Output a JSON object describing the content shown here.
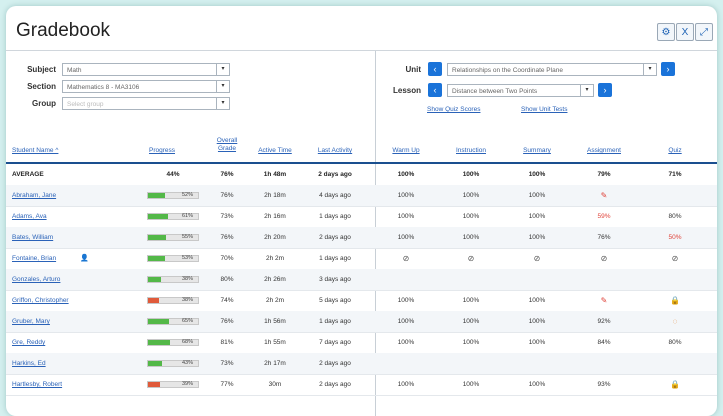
{
  "title": "Gradebook",
  "toolbar": {
    "settings_icon": "gear-icon",
    "export_icon": "excel-icon",
    "expand_icon": "expand-icon"
  },
  "filters": {
    "subject_label": "Subject",
    "subject_value": "Math",
    "section_label": "Section",
    "section_value": "Mathematics 8 - MA3106",
    "group_label": "Group",
    "group_placeholder": "Select group",
    "unit_label": "Unit",
    "unit_value": "Relationships on the Coordinate Plane",
    "lesson_label": "Lesson",
    "lesson_value": "Distance between Two Points",
    "show_quiz_scores": "Show Quiz Scores",
    "show_unit_tests": "Show Unit Tests"
  },
  "columns": {
    "student_name": "Student Name ^",
    "progress": "Progress",
    "overall_grade": "Overall Grade",
    "active_time": "Active Time",
    "last_activity": "Last Activity",
    "warm_up": "Warm Up",
    "instruction": "Instruction",
    "summary": "Summary",
    "assignment": "Assignment",
    "quiz": "Quiz"
  },
  "rows": [
    {
      "name": "AVERAGE",
      "progress": 0.44,
      "progress_text": "44%",
      "grade": "76%",
      "time": "1h 48m",
      "last": "2 days ago",
      "warm": "100%",
      "instr": "100%",
      "summ": "100%",
      "assign": "79%",
      "quiz": "71%",
      "average": true
    },
    {
      "name": "Abraham, Jane",
      "progress": 0.52,
      "progress_text": "52%",
      "grade": "76%",
      "time": "2h 18m",
      "last": "4 days ago",
      "warm": "100%",
      "instr": "100%",
      "summ": "100%",
      "assign_icon": "pencil-icon",
      "assign_glyph": "✎",
      "quiz": ""
    },
    {
      "name": "Adams, Ava",
      "progress": 0.61,
      "progress_text": "61%",
      "grade": "73%",
      "time": "2h 16m",
      "last": "1 days ago",
      "warm": "100%",
      "instr": "100%",
      "summ": "100%",
      "assign": "59%",
      "assign_red": true,
      "quiz": "80%"
    },
    {
      "name": "Bates, William",
      "progress": 0.55,
      "progress_text": "55%",
      "grade": "76%",
      "time": "2h 20m",
      "last": "2 days ago",
      "warm": "100%",
      "instr": "100%",
      "summ": "100%",
      "assign": "76%",
      "quiz": "50%",
      "quiz_red": true
    },
    {
      "name": "Fontaine, Brian",
      "progress": 0.53,
      "progress_text": "53%",
      "grade": "70%",
      "time": "2h 2m",
      "last": "1 days ago",
      "warm_icon": "cancel-icon",
      "warm_glyph": "⊘",
      "instr_icon": "cancel-icon",
      "instr_glyph": "⊘",
      "summ_icon": "cancel-icon",
      "summ_glyph": "⊘",
      "assign_icon": "cancel-icon",
      "assign_glyph": "⊘",
      "quiz_icon": "cancel-icon",
      "quiz_glyph": "⊘",
      "person": true
    },
    {
      "name": "Gonzales, Arturo",
      "progress": 0.38,
      "progress_text": "38%",
      "grade": "80%",
      "time": "2h 26m",
      "last": "3 days ago"
    },
    {
      "name": "Griffon, Christopher",
      "progress": 0.38,
      "progress_text": "38%",
      "grade": "74%",
      "time": "2h 2m",
      "last": "5 days ago",
      "warm": "100%",
      "instr": "100%",
      "summ": "100%",
      "assign_icon": "pencil-icon",
      "assign_glyph": "✎",
      "quiz_icon": "lock-icon",
      "quiz_glyph": "🔒",
      "bar_red": true
    },
    {
      "name": "Gruber, Mary",
      "progress": 0.65,
      "progress_text": "65%",
      "grade": "76%",
      "time": "1h 56m",
      "last": "1 days ago",
      "warm": "100%",
      "instr": "100%",
      "summ": "100%",
      "assign": "92%",
      "quiz_icon": "ring-icon",
      "quiz_glyph": "◌"
    },
    {
      "name": "Gre, Reddy",
      "progress": 0.68,
      "progress_text": "68%",
      "grade": "81%",
      "time": "1h 55m",
      "last": "7 days ago",
      "warm": "100%",
      "instr": "100%",
      "summ": "100%",
      "assign": "84%",
      "quiz": "80%"
    },
    {
      "name": "Harkins, Ed",
      "progress": 0.43,
      "progress_text": "43%",
      "grade": "73%",
      "time": "2h 17m",
      "last": "2 days ago"
    },
    {
      "name": "Hartlesby, Robert",
      "progress": 0.39,
      "progress_text": "39%",
      "grade": "77%",
      "time": "30m",
      "last": "2 days ago",
      "warm": "100%",
      "instr": "100%",
      "summ": "100%",
      "assign": "93%",
      "quiz_icon": "lock-icon",
      "quiz_glyph": "🔒",
      "bar_red": true
    }
  ]
}
